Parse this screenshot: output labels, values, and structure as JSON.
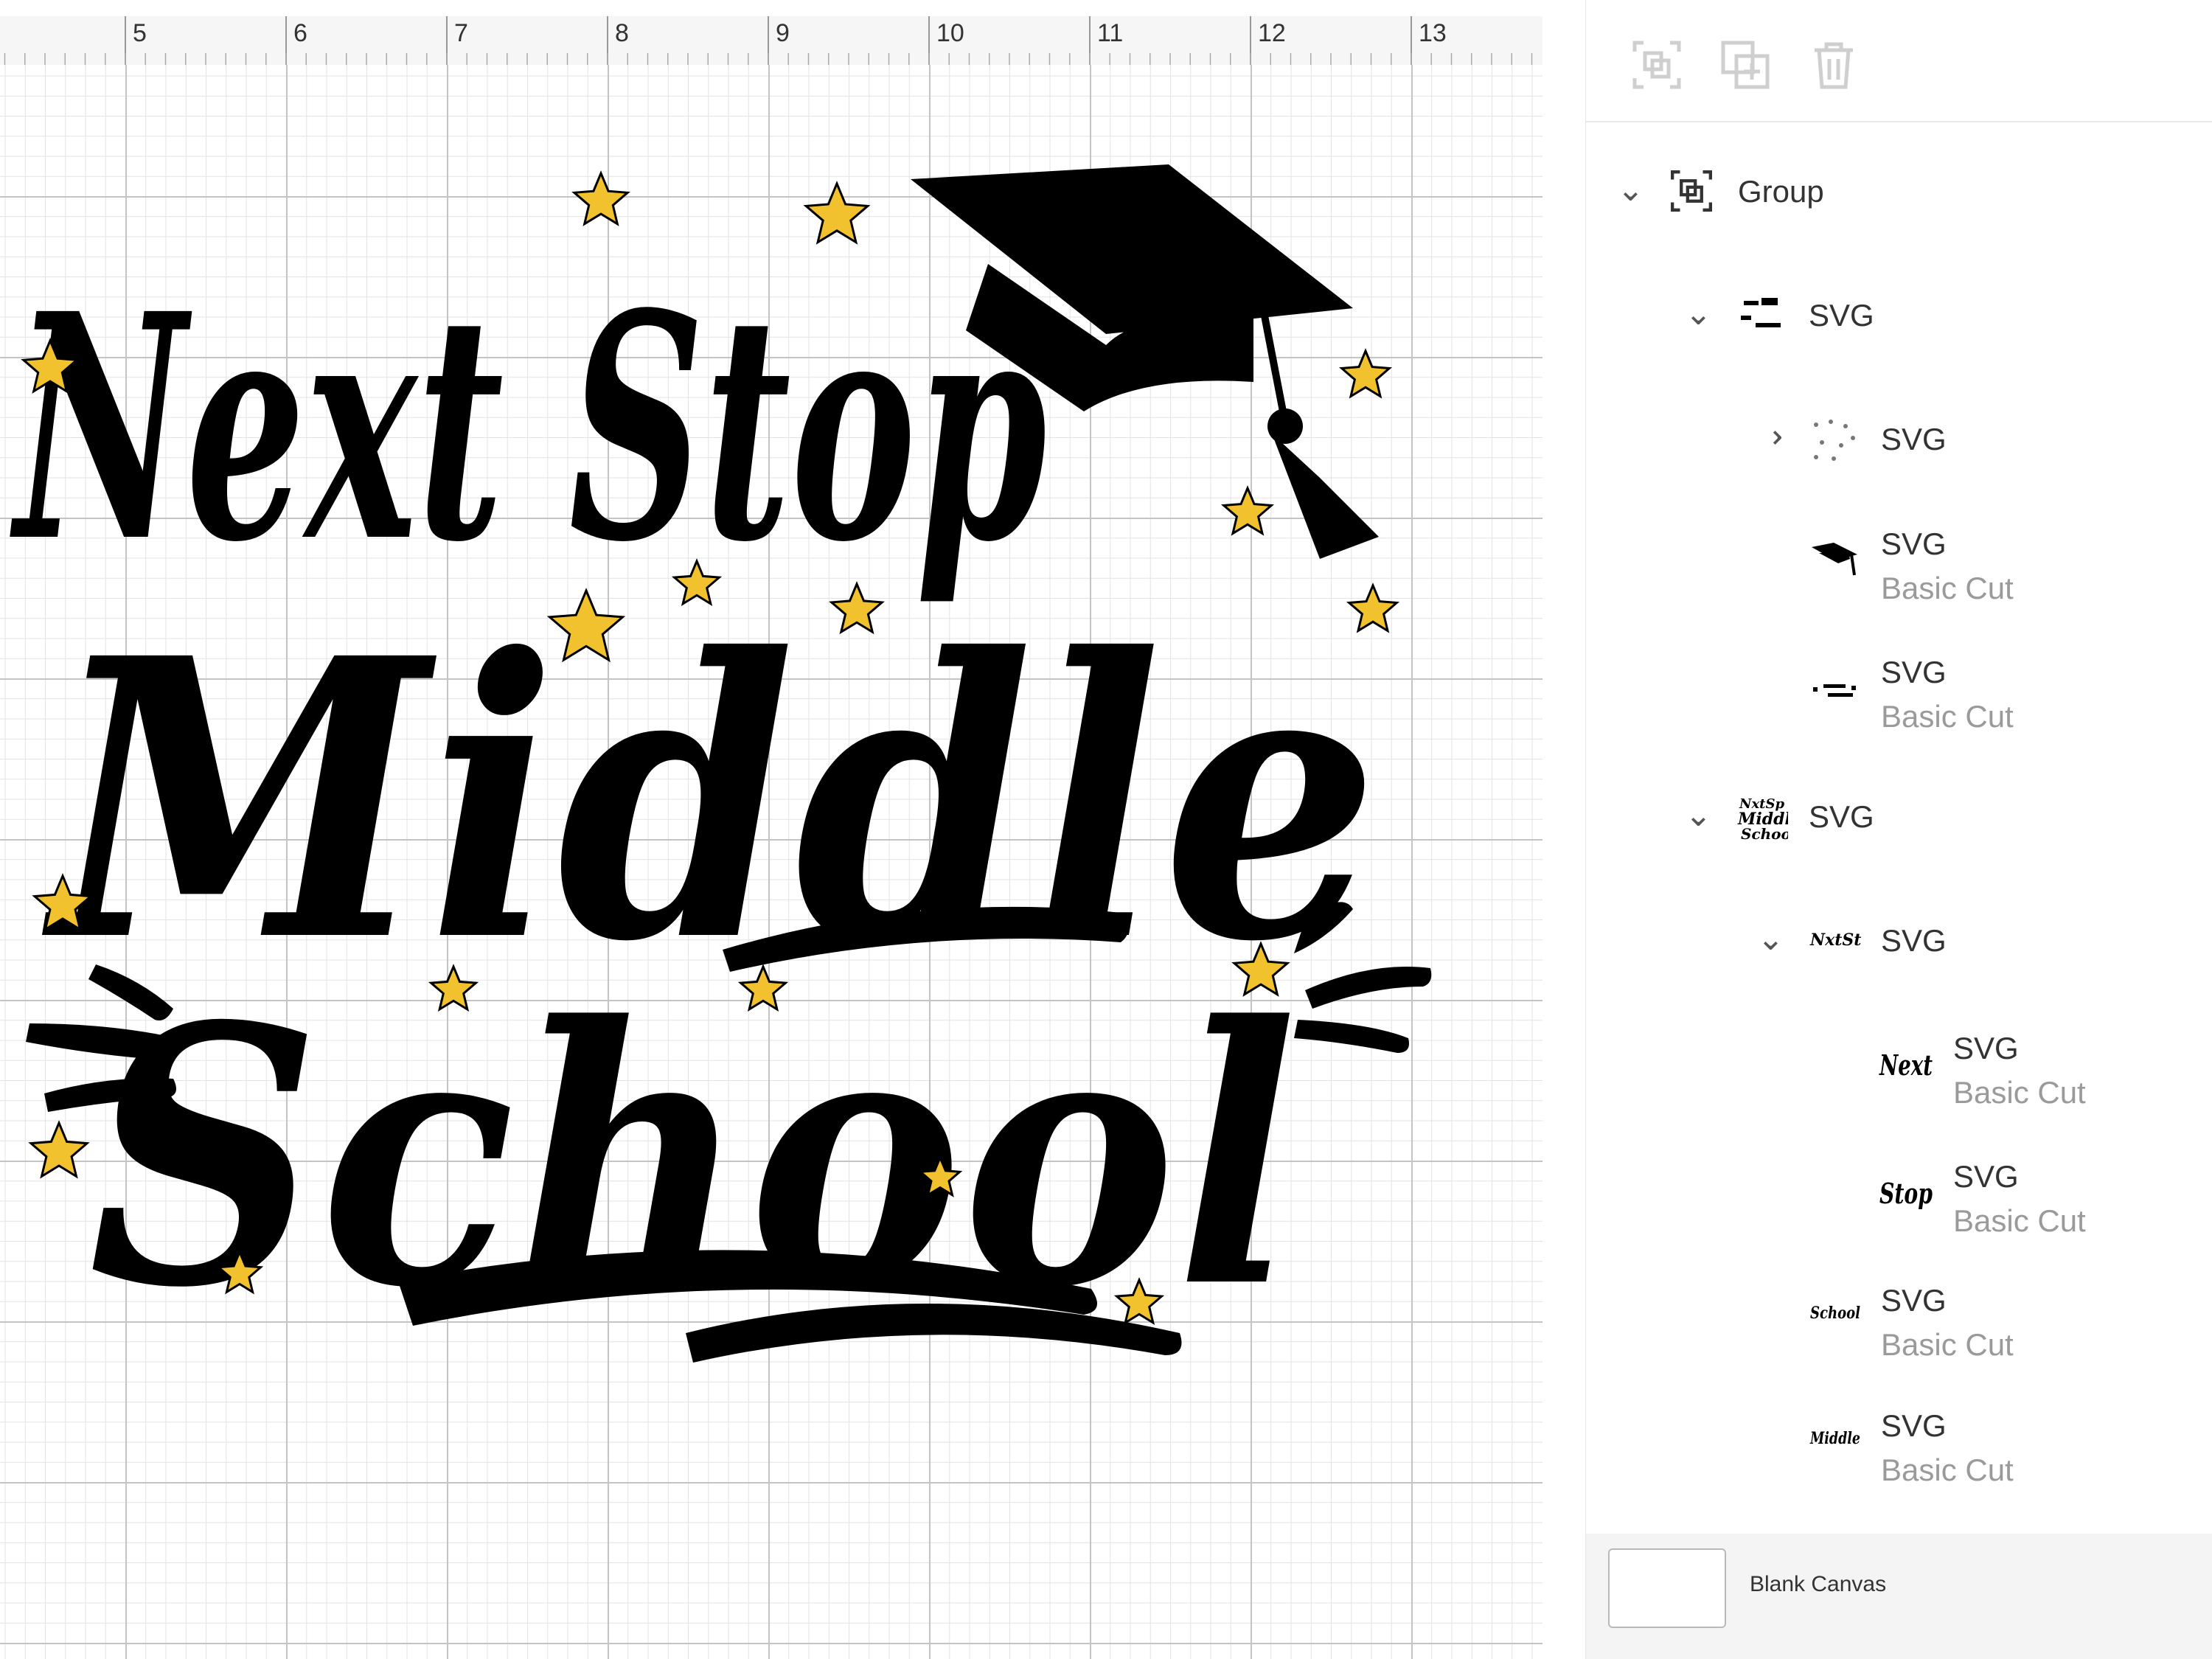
{
  "ruler": {
    "labels": [
      "5",
      "6",
      "7",
      "8",
      "9",
      "10",
      "11",
      "12",
      "13"
    ]
  },
  "artwork": {
    "line1": "Next Stop",
    "line2": "Middle",
    "line3": "School",
    "ink_color": "#000000",
    "star_color": "#f2c12e"
  },
  "toolbar": {
    "group_icon": "group-icon",
    "duplicate_icon": "duplicate-icon",
    "delete_icon": "trash-icon"
  },
  "layers": [
    {
      "id": "group",
      "name": "Group",
      "expanded": true
    },
    {
      "id": "svg-1",
      "name": "SVG",
      "expanded": true
    },
    {
      "id": "svg-1-1",
      "name": "SVG",
      "expanded": false
    },
    {
      "id": "svg-1-2",
      "name": "SVG",
      "sub": "Basic Cut"
    },
    {
      "id": "svg-1-3",
      "name": "SVG",
      "sub": "Basic Cut"
    },
    {
      "id": "svg-2",
      "name": "SVG",
      "expanded": true
    },
    {
      "id": "svg-2-1",
      "name": "SVG",
      "expanded": true
    },
    {
      "id": "svg-2-1-1",
      "name": "SVG",
      "sub": "Basic Cut",
      "thumb_text": "Next"
    },
    {
      "id": "svg-2-1-2",
      "name": "SVG",
      "sub": "Basic Cut",
      "thumb_text": "Stop"
    },
    {
      "id": "svg-2-2",
      "name": "SVG",
      "sub": "Basic Cut",
      "thumb_text": "School"
    },
    {
      "id": "svg-2-3",
      "name": "SVG",
      "sub": "Basic Cut",
      "thumb_text": "Middle"
    }
  ],
  "blank_canvas": {
    "label": "Blank Canvas"
  }
}
